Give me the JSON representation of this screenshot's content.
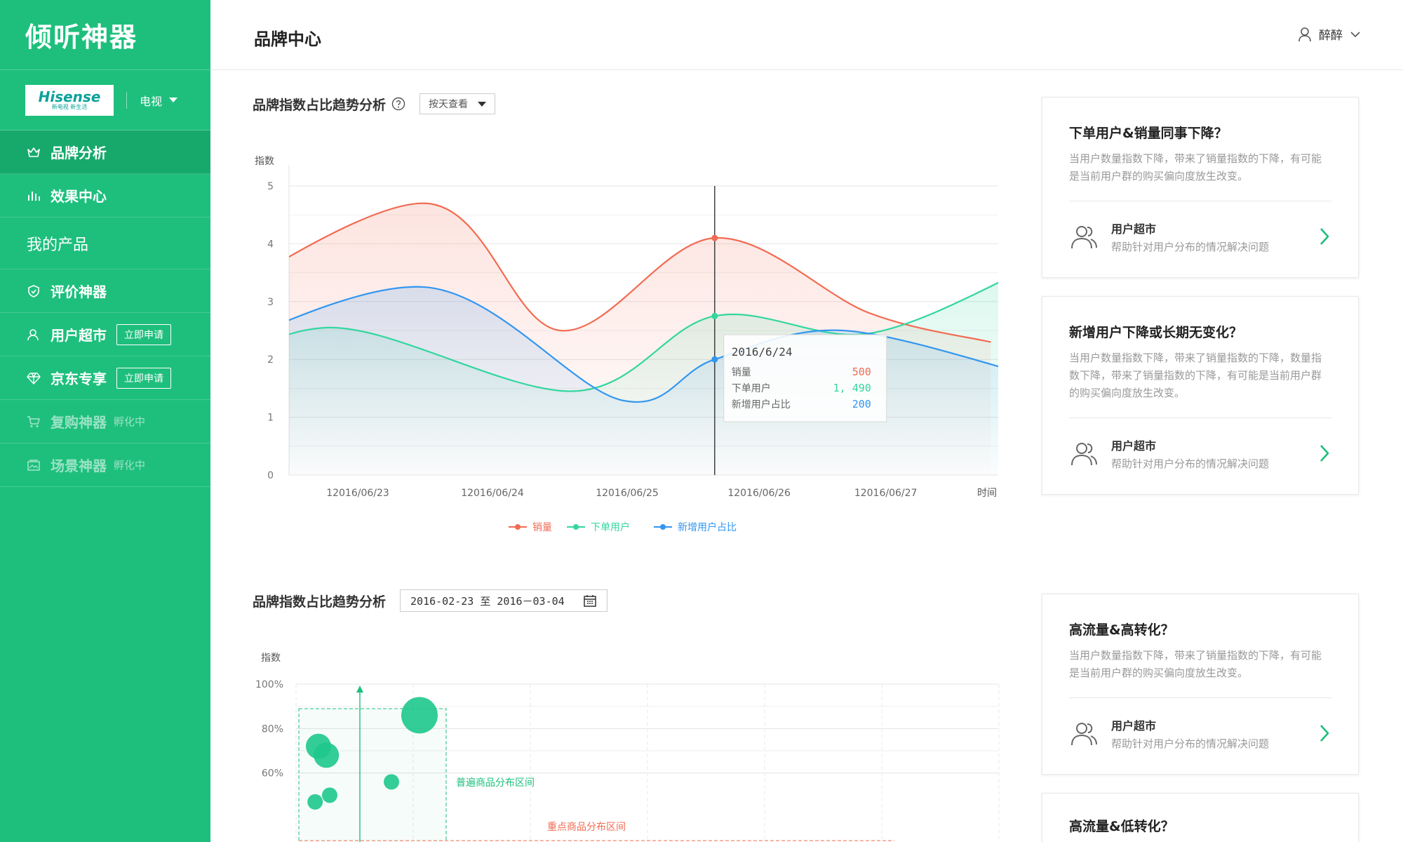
{
  "app": {
    "title": "倾听神器"
  },
  "brand": {
    "logo_main": "Hisense",
    "logo_sub": "新电视 新生活",
    "category": "电视"
  },
  "sidebar": {
    "items": [
      {
        "label": "品牌分析"
      },
      {
        "label": "效果中心"
      },
      {
        "label": "我的产品"
      },
      {
        "label": "评价神器"
      },
      {
        "label": "用户超市",
        "badge": "立即申请"
      },
      {
        "label": "京东专享",
        "badge": "立即申请"
      },
      {
        "label": "复购神器",
        "status": "孵化中"
      },
      {
        "label": "场景神器",
        "status": "孵化中"
      }
    ]
  },
  "header": {
    "title": "品牌中心",
    "user": "醉醉"
  },
  "section1": {
    "title": "品牌指数占比趋势分析",
    "select_value": "按天查看"
  },
  "section2": {
    "title": "品牌指数占比趋势分析",
    "date_range": "2016-02-23 至 2016－03-04"
  },
  "tooltip": {
    "date": "2016/6/24",
    "rows": [
      {
        "label": "销量",
        "value": "500"
      },
      {
        "label": "下单用户",
        "value": "1, 490"
      },
      {
        "label": "新增用户占比",
        "value": "200"
      }
    ]
  },
  "chart_data": [
    {
      "type": "line",
      "ylabel": "指数",
      "xlabel": "时间",
      "ylim": [
        0,
        5
      ],
      "yticks": [
        "0",
        "1",
        "2",
        "3",
        "4",
        "5"
      ],
      "categories": [
        "12016/06/23",
        "12016/06/24",
        "12016/06/25",
        "12016/06/26",
        "12016/06/27"
      ],
      "grid": true,
      "legend_position": "bottom-center",
      "series": [
        {
          "name": "销量",
          "color": "#f26b52",
          "points": [
            [
              -1.3,
              2.7
            ],
            [
              0.5,
              4.7
            ],
            [
              1.5,
              2.5
            ],
            [
              2.65,
              4.1
            ],
            [
              3.8,
              2.8
            ],
            [
              4.7,
              2.3
            ]
          ]
        },
        {
          "name": "下单用户",
          "color": "#33d69f",
          "points": [
            [
              -1.3,
              1.45
            ],
            [
              -0.2,
              2.55
            ],
            [
              1.6,
              1.45
            ],
            [
              2.65,
              2.75
            ],
            [
              3.8,
              2.45
            ],
            [
              5.0,
              3.6
            ]
          ]
        },
        {
          "name": "新增用户占比",
          "color": "#3296f0",
          "points": [
            [
              -1.3,
              1.9
            ],
            [
              0.5,
              3.25
            ],
            [
              1.95,
              1.3
            ],
            [
              2.65,
              2.0
            ],
            [
              3.6,
              2.5
            ],
            [
              5.0,
              1.72
            ]
          ]
        }
      ]
    },
    {
      "type": "scatter",
      "ylabel": "指数",
      "yticks": [
        "100%",
        "80%",
        "60%"
      ],
      "grid": true,
      "points": [
        {
          "x": 0.2,
          "y": 72,
          "r": 18
        },
        {
          "x": 0.27,
          "y": 68,
          "r": 18
        },
        {
          "x": 1.1,
          "y": 86,
          "r": 26
        },
        {
          "x": 0.85,
          "y": 56,
          "r": 11
        },
        {
          "x": 0.3,
          "y": 50,
          "r": 11
        },
        {
          "x": 0.17,
          "y": 47,
          "r": 11
        }
      ],
      "annotations": [
        {
          "text": "普遍商品分布区间",
          "color": "#1ebf7d"
        },
        {
          "text": "重点商品分布区间",
          "color": "#f26b52"
        }
      ]
    }
  ],
  "cards": [
    {
      "title": "下单用户&销量同事下降？",
      "desc": "当用户数量指数下降，带来了销量指数的下降，有可能是当前用户群的购买偏向度放生改变。",
      "link_title": "用户超市",
      "link_sub": "帮助针对用户分布的情况解决问题"
    },
    {
      "title": "新增用户下降或长期无变化？",
      "desc": "当用户数量指数下降，带来了销量指数的下降，数量指数下降，带来了销量指数的下降，有可能是当前用户群的购买偏向度放生改变。",
      "link_title": "用户超市",
      "link_sub": "帮助针对用户分布的情况解决问题"
    },
    {
      "title": "高流量&高转化？",
      "desc": "当用户数量指数下降，带来了销量指数的下降，有可能是当前用户群的购买偏向度放生改变。",
      "link_title": "用户超市",
      "link_sub": "帮助针对用户分布的情况解决问题"
    },
    {
      "title": "高流量&低转化？",
      "desc": "",
      "link_title": "",
      "link_sub": ""
    }
  ],
  "colors": {
    "sidebar": "#1ebf7d",
    "sidebar_active": "#17a96c",
    "accent": "#1ebf7d"
  }
}
